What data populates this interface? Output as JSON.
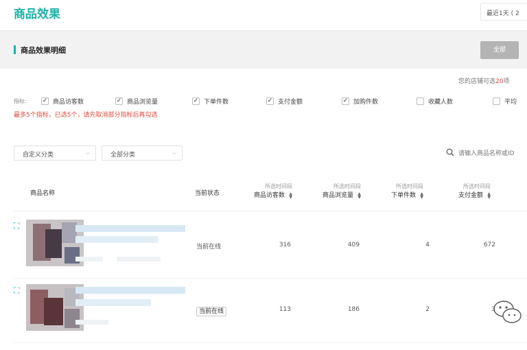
{
  "header": {
    "title": "商品效果",
    "date_range_label": "最近1天 ( 2"
  },
  "section": {
    "title": "商品效果明细",
    "all_button": "全部"
  },
  "metric_panel": {
    "limit_prefix": "您的店铺可选",
    "limit_num": "20",
    "limit_suffix": "项",
    "label": "指标:",
    "items": [
      {
        "label": "商品访客数",
        "checked": true
      },
      {
        "label": "商品浏览量",
        "checked": true
      },
      {
        "label": "下单件数",
        "checked": true
      },
      {
        "label": "支付金额",
        "checked": true
      },
      {
        "label": "加购件数",
        "checked": true
      },
      {
        "label": "收藏人数",
        "checked": false
      },
      {
        "label": "平均",
        "checked": false
      }
    ],
    "warning": "最多5个指标，已选5个，请先取消部分指标后再勾选"
  },
  "filters": {
    "category": "自定义分类",
    "status": "全部分类",
    "search_placeholder": "请输入商品名称或ID"
  },
  "table": {
    "columns": [
      {
        "sub": "",
        "main": "商品名称"
      },
      {
        "sub": "",
        "main": "当前状态"
      },
      {
        "sub": "所选时间段",
        "main": "商品访客数"
      },
      {
        "sub": "所选时间段",
        "main": "商品浏览量"
      },
      {
        "sub": "所选时间段",
        "main": "下单件数"
      },
      {
        "sub": "所选时间段",
        "main": "支付金额"
      }
    ],
    "rows": [
      {
        "status": "当前在线",
        "visitors": "316",
        "pageviews": "409",
        "orders": "4",
        "amount": "672"
      },
      {
        "status": "当前在线",
        "visitors": "113",
        "pageviews": "186",
        "orders": "2",
        "amount": "3"
      }
    ]
  },
  "colors": {
    "accent": "#1ab3a6",
    "warning": "#e24a3b",
    "button_gray": "#b4b4b4",
    "section_bg": "#f2f2f2"
  },
  "icons": {
    "search": "search-icon",
    "sort": "sort-icon",
    "watermark": "wechat-watermark-icon"
  }
}
